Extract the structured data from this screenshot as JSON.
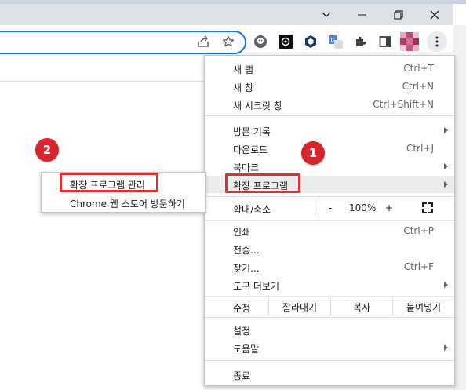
{
  "window_controls": [
    "chevron-down-icon",
    "minimize-icon",
    "restore-icon",
    "close-icon"
  ],
  "toolbar_icons": [
    "share-icon",
    "bookmark-star-icon",
    "ghost-extension-icon",
    "openai-extension-icon",
    "hex-extension-icon",
    "translate-extension-icon",
    "puzzle-extensions-icon",
    "side-panel-icon",
    "profile-avatar",
    "more-menu-icon"
  ],
  "menu": {
    "new_tab": {
      "label": "새 탭",
      "shortcut": "Ctrl+T"
    },
    "new_window": {
      "label": "새 창",
      "shortcut": "Ctrl+N"
    },
    "incognito": {
      "label": "새 시크릿 창",
      "shortcut": "Ctrl+Shift+N"
    },
    "history": {
      "label": "방문 기록"
    },
    "downloads": {
      "label": "다운로드",
      "shortcut": "Ctrl+J"
    },
    "bookmarks": {
      "label": "북마크"
    },
    "extensions": {
      "label": "확장 프로그램"
    },
    "zoom": {
      "label": "확대/축소",
      "minus": "-",
      "value": "100%",
      "plus": "+"
    },
    "print": {
      "label": "인쇄",
      "shortcut": "Ctrl+P"
    },
    "cast": {
      "label": "전송..."
    },
    "find": {
      "label": "찾기...",
      "shortcut": "Ctrl+F"
    },
    "more_tools": {
      "label": "도구 더보기"
    },
    "edit": {
      "label": "수정",
      "cut": "잘라내기",
      "copy": "복사",
      "paste": "붙여넣기"
    },
    "settings": {
      "label": "설정"
    },
    "help": {
      "label": "도움말"
    },
    "exit": {
      "label": "종료"
    }
  },
  "submenu": {
    "manage": "확장 프로그램 관리",
    "store": "Chrome 웹 스토어 방문하기"
  },
  "annotations": {
    "step1": "1",
    "step2": "2"
  },
  "colors": {
    "accent": "#1a73e8",
    "annotation_red": "#e03131",
    "badge_red": "#d7252d"
  }
}
